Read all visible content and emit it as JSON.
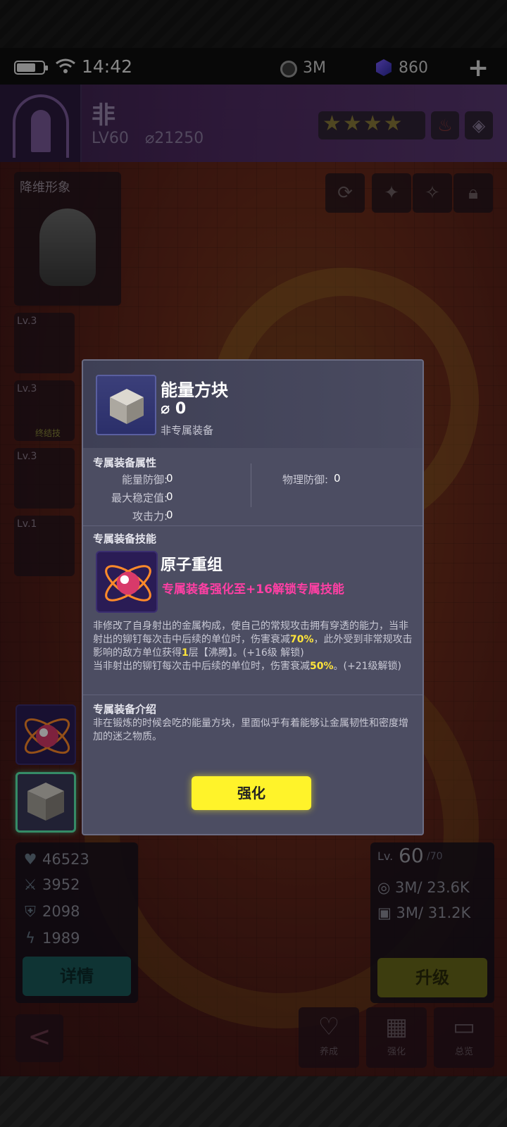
{
  "status_bar": {
    "time": "14:42",
    "coin_value": "3M",
    "gem_value": "860",
    "add_label": "+"
  },
  "header": {
    "name": "非",
    "level": "LV60",
    "power": "21250",
    "stars": "★★★★",
    "element_icon": "fire-icon",
    "role_icon": "diamond-icon"
  },
  "left_panel": {
    "skin_label": "降维形象",
    "skills": [
      {
        "level": "Lv.3",
        "tag": ""
      },
      {
        "level": "Lv.3",
        "tag": "终结技"
      },
      {
        "level": "Lv.3",
        "tag": ""
      },
      {
        "level": "Lv.1",
        "tag": ""
      }
    ]
  },
  "top_buttons": [
    "refresh-icon",
    "sparkle-icon",
    "sparkles-icon",
    "lock-icon"
  ],
  "stats": {
    "hp": "46523",
    "attack": "3952",
    "defense": "2098",
    "energy": "1989",
    "detail_label": "详情"
  },
  "level_panel": {
    "label": "Lv.",
    "level": "60",
    "max": "/70",
    "coin": "3M/ 23.6K",
    "xp": "3M/ 31.2K",
    "upgrade_label": "升级"
  },
  "nav": {
    "back": "<",
    "items": [
      {
        "label": "养成",
        "icon": "heart-icon"
      },
      {
        "label": "强化",
        "icon": "chip-icon"
      },
      {
        "label": "总览",
        "icon": "folder-icon"
      }
    ]
  },
  "modal": {
    "title": "能量方块",
    "power": "0",
    "subtitle": "非专属装备",
    "attr_title": "专属装备属性",
    "attrs_left": [
      {
        "label": "能量防御:",
        "value": "0"
      },
      {
        "label": "最大稳定值:",
        "value": "0"
      },
      {
        "label": "攻击力:",
        "value": "0"
      }
    ],
    "attrs_right": [
      {
        "label": "物理防御:",
        "value": "0"
      }
    ],
    "skill_title": "专属装备技能",
    "skill_name": "原子重组",
    "skill_condition": "专属装备强化至+16解锁专属技能",
    "skill_desc_1": "非修改了自身射出的金属构成，使自己的常规攻击拥有穿透的能力，当非射出的铆钉每次击中后续的单位时，伤害衰减",
    "skill_desc_hl1": "70%",
    "skill_desc_2": "，此外受到非常规攻击影响的敌方单位获得",
    "skill_desc_hl2": "1",
    "skill_desc_3": "层【沸腾】。(+16级 解锁)",
    "skill_desc_4": "当非射出的铆钉每次击中后续的单位时，伤害衰减",
    "skill_desc_hl3": "50%",
    "skill_desc_5": "。(+21级解锁)",
    "intro_title": "专属装备介绍",
    "intro_text": "非在锻炼的时候会吃的能量方块，里面似乎有着能够让金属韧性和密度增加的迷之物质。",
    "button_label": "强化"
  }
}
